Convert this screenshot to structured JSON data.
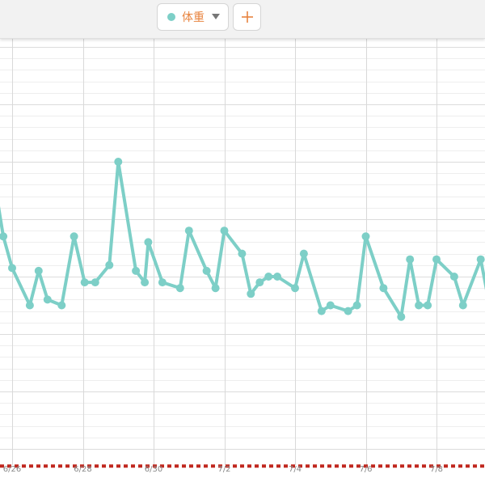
{
  "toolbar": {
    "series_label": "体重",
    "series_color": "#7dcfc7",
    "label_color": "#e8843f",
    "add_label": "+"
  },
  "chart_data": {
    "type": "line",
    "x_tick_labels": [
      "6/26",
      "6/28",
      "6/30",
      "7/2",
      "7/4",
      "7/6",
      "7/8"
    ],
    "series": [
      {
        "name": "体重",
        "color": "#7dcfc7",
        "x": [
          25.5,
          25.75,
          26.0,
          26.5,
          26.75,
          27.0,
          27.4,
          27.75,
          28.05,
          28.35,
          28.75,
          29.0,
          29.5,
          29.75,
          29.85,
          30.25,
          30.75,
          31.0,
          31.5,
          31.75,
          32.0,
          32.5,
          32.75,
          33.0,
          33.25,
          33.5,
          34.0,
          34.25,
          34.75,
          35.0,
          35.5,
          35.75,
          36.0,
          36.5,
          37.0,
          37.25,
          37.5,
          37.75,
          38.0,
          38.5,
          38.75,
          39.25,
          39.5
        ],
        "values": [
          58.8,
          57.85,
          57.3,
          56.65,
          57.25,
          56.75,
          56.65,
          57.85,
          57.05,
          57.05,
          57.35,
          59.15,
          57.25,
          57.05,
          57.75,
          57.05,
          56.95,
          57.95,
          57.25,
          56.95,
          57.95,
          57.55,
          56.85,
          57.05,
          57.15,
          57.15,
          56.95,
          57.55,
          56.55,
          56.65,
          56.55,
          56.65,
          57.85,
          56.95,
          56.45,
          57.45,
          56.65,
          56.65,
          57.45,
          57.15,
          56.65,
          57.45,
          56.65
        ]
      },
      {
        "name": "",
        "color": "#c0281f",
        "x": [
          25.5,
          39.5
        ],
        "values": [
          53.85,
          53.85
        ]
      }
    ],
    "xlim": [
      25.5,
      39.6
    ],
    "ylim": [
      53.8,
      60.5
    ],
    "grid": true
  }
}
